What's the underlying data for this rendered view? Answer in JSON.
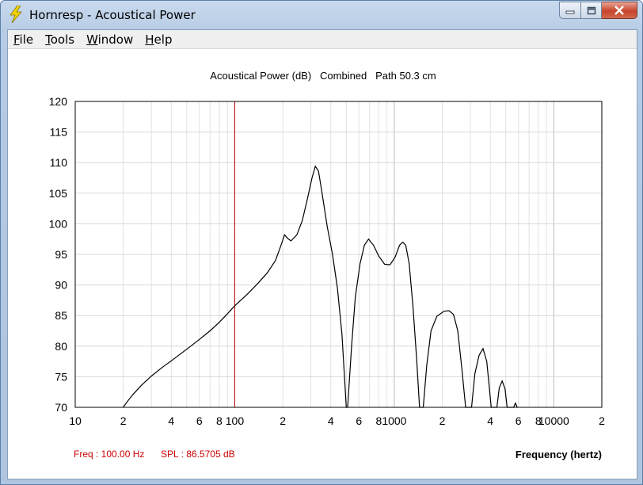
{
  "window": {
    "title": "Hornresp - Acoustical Power",
    "icon": "lightning-bolt-icon"
  },
  "menu": [
    {
      "first": "F",
      "rest": "ile"
    },
    {
      "first": "T",
      "rest": "ools"
    },
    {
      "first": "W",
      "rest": "indow"
    },
    {
      "first": "H",
      "rest": "elp"
    }
  ],
  "readout": {
    "freq": "Freq : 100.00 Hz",
    "spl": "SPL : 86.5705 dB",
    "color": "#cc0000"
  },
  "chart_data": {
    "type": "line",
    "title": "Acoustical Power (dB)   Combined   Path 50.3 cm",
    "xlabel": "Frequency (hertz)",
    "ylabel": "",
    "x_scale": "log",
    "xlim": [
      10,
      20000
    ],
    "ylim": [
      70,
      120
    ],
    "y_ticks": [
      70,
      75,
      80,
      85,
      90,
      95,
      100,
      105,
      110,
      115,
      120
    ],
    "x_tick_labels": [
      {
        "x": 10,
        "label": "10"
      },
      {
        "x": 20,
        "label": "2"
      },
      {
        "x": 40,
        "label": "4"
      },
      {
        "x": 60,
        "label": "6"
      },
      {
        "x": 80,
        "label": "8"
      },
      {
        "x": 100,
        "label": "100"
      },
      {
        "x": 200,
        "label": "2"
      },
      {
        "x": 400,
        "label": "4"
      },
      {
        "x": 600,
        "label": "6"
      },
      {
        "x": 800,
        "label": "8"
      },
      {
        "x": 1000,
        "label": "1000"
      },
      {
        "x": 2000,
        "label": "2"
      },
      {
        "x": 4000,
        "label": "4"
      },
      {
        "x": 6000,
        "label": "6"
      },
      {
        "x": 8000,
        "label": "8"
      },
      {
        "x": 10000,
        "label": "10000"
      },
      {
        "x": 20000,
        "label": "2"
      }
    ],
    "grid": true,
    "cursor_x": 100,
    "cursor_color": "#cc0000",
    "line_color": "#000000",
    "series": [
      {
        "values": [
          [
            20,
            70
          ],
          [
            21,
            70.8
          ],
          [
            23,
            72.1
          ],
          [
            26,
            73.6
          ],
          [
            30,
            75.1
          ],
          [
            35,
            76.5
          ],
          [
            40,
            77.6
          ],
          [
            50,
            79.5
          ],
          [
            60,
            81.1
          ],
          [
            70,
            82.5
          ],
          [
            80,
            83.9
          ],
          [
            90,
            85.3
          ],
          [
            100,
            86.6
          ],
          [
            120,
            88.5
          ],
          [
            140,
            90.3
          ],
          [
            160,
            92.0
          ],
          [
            180,
            94.0
          ],
          [
            195,
            96.5
          ],
          [
            205,
            98.2
          ],
          [
            215,
            97.6
          ],
          [
            225,
            97.2
          ],
          [
            245,
            98.2
          ],
          [
            265,
            100.5
          ],
          [
            285,
            104.0
          ],
          [
            305,
            107.5
          ],
          [
            320,
            109.4
          ],
          [
            335,
            108.6
          ],
          [
            350,
            105.5
          ],
          [
            380,
            99.5
          ],
          [
            410,
            95.0
          ],
          [
            440,
            89.5
          ],
          [
            470,
            82.0
          ],
          [
            500,
            70
          ],
          [
            510,
            70
          ],
          [
            540,
            80.0
          ],
          [
            570,
            88.0
          ],
          [
            610,
            93.5
          ],
          [
            650,
            96.5
          ],
          [
            690,
            97.5
          ],
          [
            740,
            96.5
          ],
          [
            800,
            94.7
          ],
          [
            870,
            93.4
          ],
          [
            940,
            93.3
          ],
          [
            1010,
            94.5
          ],
          [
            1080,
            96.5
          ],
          [
            1130,
            97.0
          ],
          [
            1180,
            96.5
          ],
          [
            1240,
            93.5
          ],
          [
            1310,
            86.5
          ],
          [
            1380,
            78.0
          ],
          [
            1440,
            70
          ],
          [
            1520,
            70
          ],
          [
            1600,
            77.0
          ],
          [
            1700,
            82.5
          ],
          [
            1850,
            84.9
          ],
          [
            2050,
            85.7
          ],
          [
            2200,
            85.8
          ],
          [
            2350,
            85.2
          ],
          [
            2500,
            82.5
          ],
          [
            2660,
            76.0
          ],
          [
            2800,
            70
          ],
          [
            3050,
            70
          ],
          [
            3200,
            75.5
          ],
          [
            3400,
            78.5
          ],
          [
            3600,
            79.6
          ],
          [
            3800,
            77.5
          ],
          [
            3950,
            73.0
          ],
          [
            4050,
            70
          ],
          [
            4400,
            70
          ],
          [
            4550,
            73.2
          ],
          [
            4750,
            74.3
          ],
          [
            4950,
            73.0
          ],
          [
            5100,
            70
          ],
          [
            5600,
            70
          ],
          [
            5750,
            70.7
          ],
          [
            5900,
            70
          ]
        ]
      }
    ]
  }
}
